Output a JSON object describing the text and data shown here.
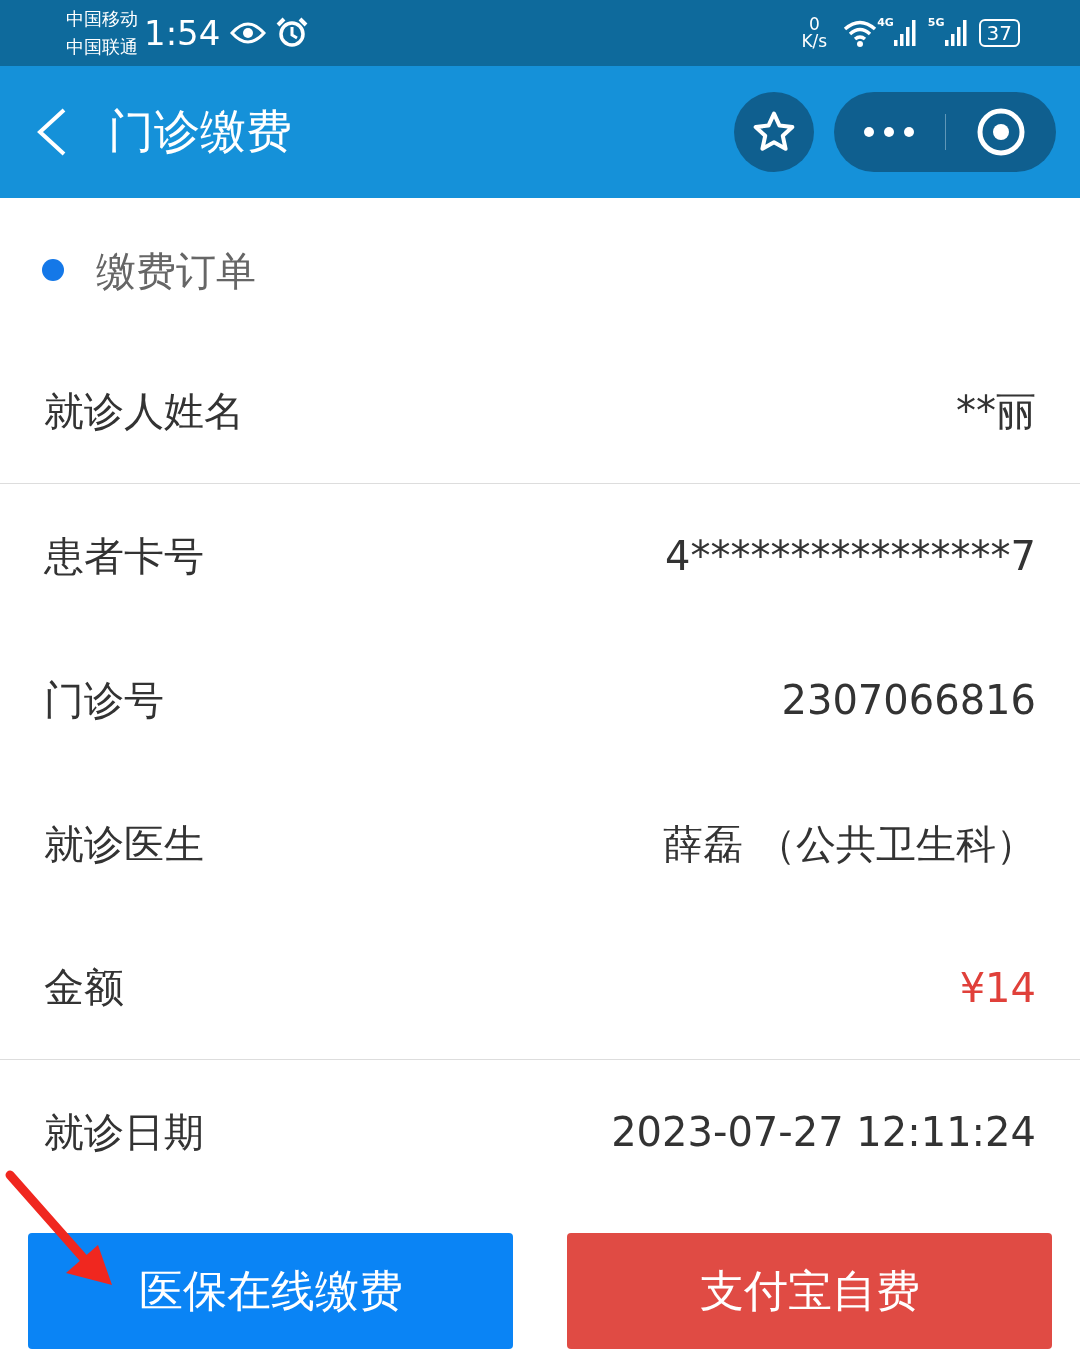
{
  "status_bar": {
    "carriers": [
      "中国移动",
      "中国联通"
    ],
    "time": "1:54",
    "speed_value": "0",
    "speed_unit": "K/s",
    "network_1": "4G",
    "network_2": "5G",
    "battery": "37"
  },
  "header": {
    "title": "门诊缴费"
  },
  "section": {
    "title": "缴费订单"
  },
  "rows": [
    {
      "label": "就诊人姓名",
      "value": "**丽",
      "kind": "text",
      "divider_after": true
    },
    {
      "label": "患者卡号",
      "value": "4****************7",
      "kind": "text",
      "divider_after": false
    },
    {
      "label": "门诊号",
      "value": "2307066816",
      "kind": "text",
      "divider_after": false
    },
    {
      "label": "就诊医生",
      "value": "薛磊 （公共卫生科）",
      "kind": "text",
      "divider_after": false
    },
    {
      "label": "金额",
      "value": "¥14",
      "kind": "amount",
      "divider_after": true
    },
    {
      "label": "就诊日期",
      "value": "2023-07-27 12:11:24",
      "kind": "text",
      "divider_after": false
    }
  ],
  "buttons": [
    {
      "label": "医保在线缴费",
      "kind": "primary"
    },
    {
      "label": "支付宝自费",
      "kind": "danger"
    }
  ]
}
